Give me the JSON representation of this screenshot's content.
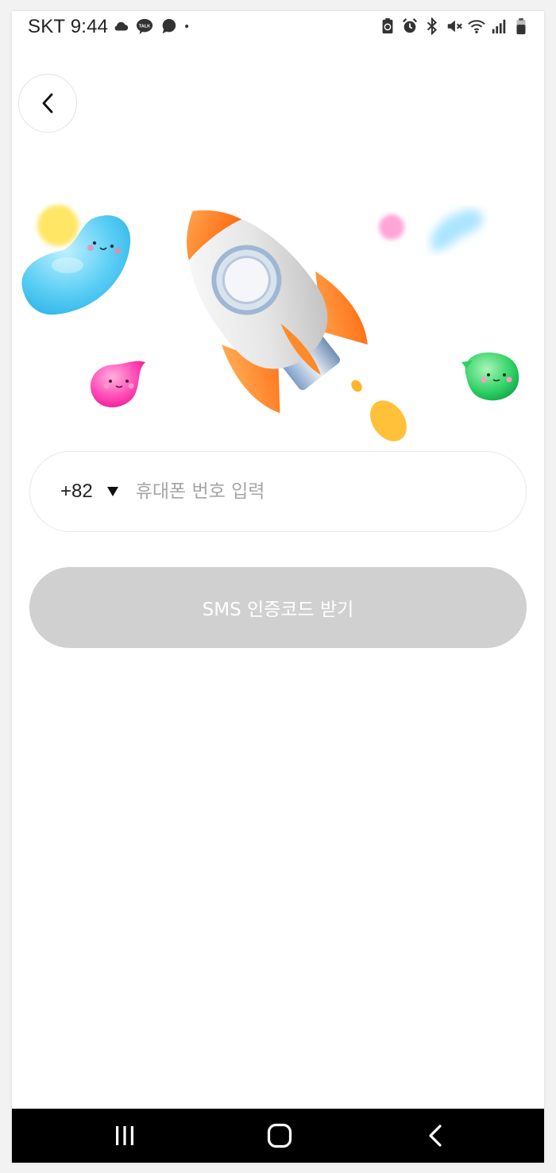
{
  "status_bar": {
    "carrier": "SKT",
    "time": "9:44",
    "left_icons": [
      "cloud-icon",
      "kakaotalk-icon",
      "chat-bubble-icon",
      "dot-icon"
    ],
    "right_icons": [
      "battery-saver-icon",
      "alarm-icon",
      "bluetooth-icon",
      "mute-icon",
      "wifi-icon",
      "signal-icon",
      "battery-icon"
    ]
  },
  "header": {
    "back_icon": "chevron-left-icon"
  },
  "form": {
    "country_code": "+82",
    "phone_placeholder": "휴대폰 번호 입력",
    "phone_value": "",
    "submit_label": "SMS 인증코드 받기",
    "submit_enabled": false
  },
  "colors": {
    "button_disabled": "#d0d0d0",
    "rocket_accent": "#ff7a1a"
  },
  "nav_bar": {
    "icons": [
      "recent-apps-icon",
      "home-icon",
      "back-icon"
    ]
  }
}
